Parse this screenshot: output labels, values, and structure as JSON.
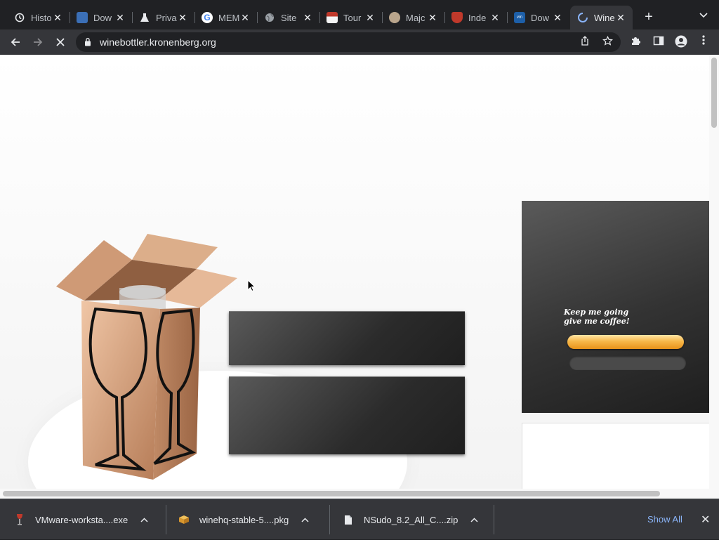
{
  "browser": {
    "tabs": [
      {
        "title": "Histo",
        "icon": "history-icon",
        "active": false
      },
      {
        "title": "Dow",
        "icon": "download-site-icon",
        "active": false
      },
      {
        "title": "Priva",
        "icon": "flask-icon",
        "active": false
      },
      {
        "title": "MEM",
        "icon": "google-icon",
        "active": false
      },
      {
        "title": "Site",
        "icon": "globe-icon",
        "active": false
      },
      {
        "title": "Tour",
        "icon": "tour-site-icon",
        "active": false
      },
      {
        "title": "Majc",
        "icon": "majc-site-icon",
        "active": false
      },
      {
        "title": "Inde",
        "icon": "wine-site-icon",
        "active": false
      },
      {
        "title": "Dow",
        "icon": "vmware-icon",
        "active": false
      },
      {
        "title": "Wine",
        "icon": "loading-spinner-icon",
        "active": true
      }
    ],
    "url": "winebottler.kronenberg.org"
  },
  "page": {
    "coffee_text": "Keep me going\ngive me coffee!"
  },
  "downloads": [
    {
      "name": "VMware-worksta....exe",
      "icon": "wine-glass-file-icon"
    },
    {
      "name": "winehq-stable-5....pkg",
      "icon": "package-icon"
    },
    {
      "name": "NSudo_8.2_All_C....zip",
      "icon": "file-icon"
    }
  ],
  "downloads_bar": {
    "show_all": "Show All"
  },
  "colors": {
    "tab_strip": "#202124",
    "toolbar": "#35363a",
    "accent_link": "#8ab4f8",
    "coffee_button": "#f7b84a"
  }
}
